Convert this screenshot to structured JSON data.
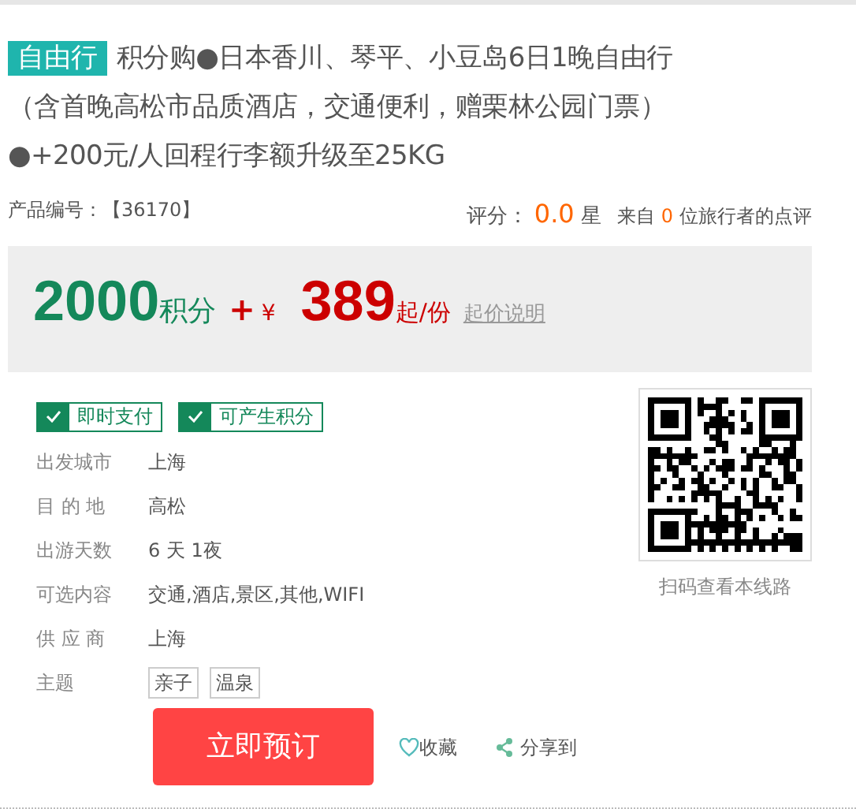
{
  "product": {
    "tag": "自由行",
    "title_lines": [
      "积分购●日本香川、琴平、小豆岛6日1晚自由行",
      "（含首晚高松市品质酒店，交通便利，赠栗林公园门票）",
      "●+200元/人回程行李额升级至25KG"
    ],
    "code_label": "产品编号：",
    "code": "【36170】",
    "rating_label": "评分：",
    "rating": "0.0",
    "rating_unit": "星",
    "review_prefix": "来自",
    "review_count": "0",
    "review_suffix": "位旅行者的点评"
  },
  "price": {
    "points": "2000",
    "points_unit": "积分",
    "plus": "+",
    "currency": "¥",
    "amount": "389",
    "amount_unit": "起/份",
    "note_link": "起价说明"
  },
  "badges": [
    {
      "label": "即时支付",
      "checked": true
    },
    {
      "label": "可产生积分",
      "checked": true
    }
  ],
  "details": [
    {
      "label": "出发城市",
      "value": "上海"
    },
    {
      "label": "目 的 地",
      "value": "高松"
    },
    {
      "label": "出游天数",
      "value": "6 天 1夜"
    },
    {
      "label": "可选内容",
      "value": "交通,酒店,景区,其他,WIFI"
    },
    {
      "label": "供 应 商",
      "value": "上海"
    },
    {
      "label": "主题",
      "tags": [
        "亲子",
        "温泉"
      ]
    }
  ],
  "qr": {
    "caption": "扫码查看本线路"
  },
  "actions": {
    "book": "立即预订",
    "favorite": "收藏",
    "share": "分享到"
  }
}
